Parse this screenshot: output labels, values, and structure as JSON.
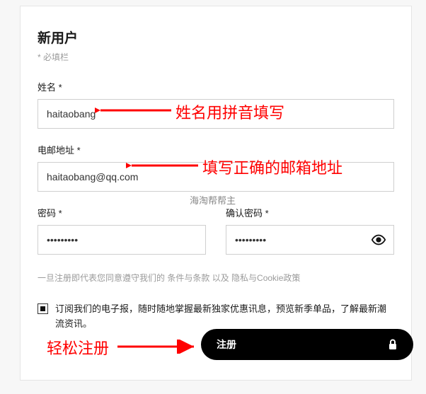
{
  "title": "新用户",
  "required_note": "* 必填栏",
  "fields": {
    "name": {
      "label": "姓名 *",
      "value": "haitaobang"
    },
    "email": {
      "label": "电邮地址 *",
      "value": "haitaobang@qq.com"
    },
    "password": {
      "label": "密码 *",
      "value": "•••••••••"
    },
    "confirm": {
      "label": "确认密码 *",
      "value": "•••••••••"
    }
  },
  "watermark_overlap": "海淘帮帮主",
  "disclaimer": {
    "prefix": "一旦注册即代表您同意遵守我们的 ",
    "terms": "条件与条款",
    "mid": " 以及 ",
    "privacy": "隐私与Cookie政策"
  },
  "newsletter": {
    "checked": true,
    "label": "订阅我们的电子报，随时随地掌握最新独家优惠讯息，预览新季单品，了解最新潮流资讯。"
  },
  "submit_label": "注册",
  "annotations": {
    "name_hint": "姓名用拼音填写",
    "email_hint": "填写正确的邮箱地址",
    "register_hint": "轻松注册"
  }
}
